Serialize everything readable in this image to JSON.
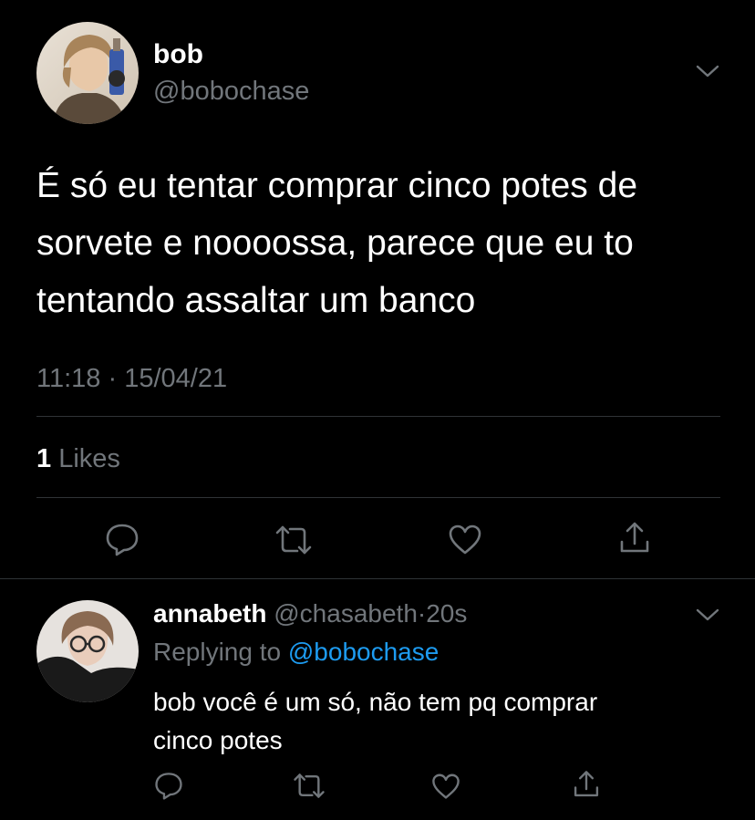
{
  "colors": {
    "background": "#000000",
    "text": "#ffffff",
    "muted": "#71767b",
    "link": "#1d9bf0",
    "divider": "#2f3336"
  },
  "tweet": {
    "author_name": "bob",
    "author_handle": "@bobochase",
    "text_lines": [
      "É só eu tentar comprar cinco potes de",
      "sorvete e noooossa, parece que eu to",
      "tentando assaltar um banco"
    ],
    "time": "11:18",
    "separator": "·",
    "date": "15/04/21",
    "likes_count": "1",
    "likes_label": "Likes",
    "icons": [
      "reply-icon",
      "retweet-icon",
      "like-icon",
      "share-icon",
      "chevron-down-icon"
    ]
  },
  "reply": {
    "author_name": "annabeth",
    "author_handle": "@chasabeth",
    "separator": "·",
    "age": "20s",
    "replying_prefix": "Replying to",
    "replying_handle": "@bobochase",
    "text_lines": [
      "bob você é um só, não tem pq comprar",
      "cinco potes"
    ]
  }
}
